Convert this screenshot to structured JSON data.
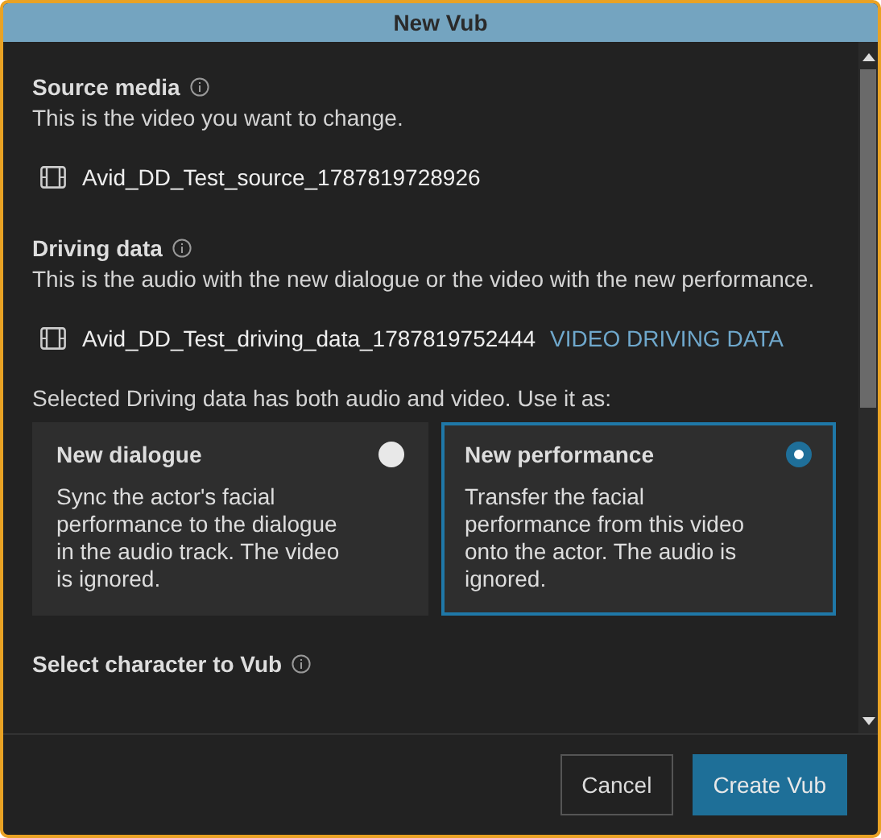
{
  "window": {
    "title": "New Vub"
  },
  "source": {
    "heading": "Source media",
    "description": "This is the video you want to change.",
    "file": "Avid_DD_Test_source_1787819728926"
  },
  "driving": {
    "heading": "Driving data",
    "description": "This is the audio with the new dialogue or the video with the new performance.",
    "file": "Avid_DD_Test_driving_data_1787819752444",
    "tag": "VIDEO DRIVING DATA"
  },
  "use_prompt": "Selected Driving data has both audio and video. Use it as:",
  "options": [
    {
      "title": "New dialogue",
      "description": "Sync the actor's facial performance to the dialogue in the audio track. The video is ignored.",
      "selected": false
    },
    {
      "title": "New performance",
      "description": "Transfer the facial performance from this video onto the actor. The audio is ignored.",
      "selected": true
    }
  ],
  "character": {
    "heading": "Select character to Vub"
  },
  "buttons": [
    {
      "label": "Cancel",
      "kind": "secondary"
    },
    {
      "label": "Create Vub",
      "kind": "primary"
    }
  ]
}
